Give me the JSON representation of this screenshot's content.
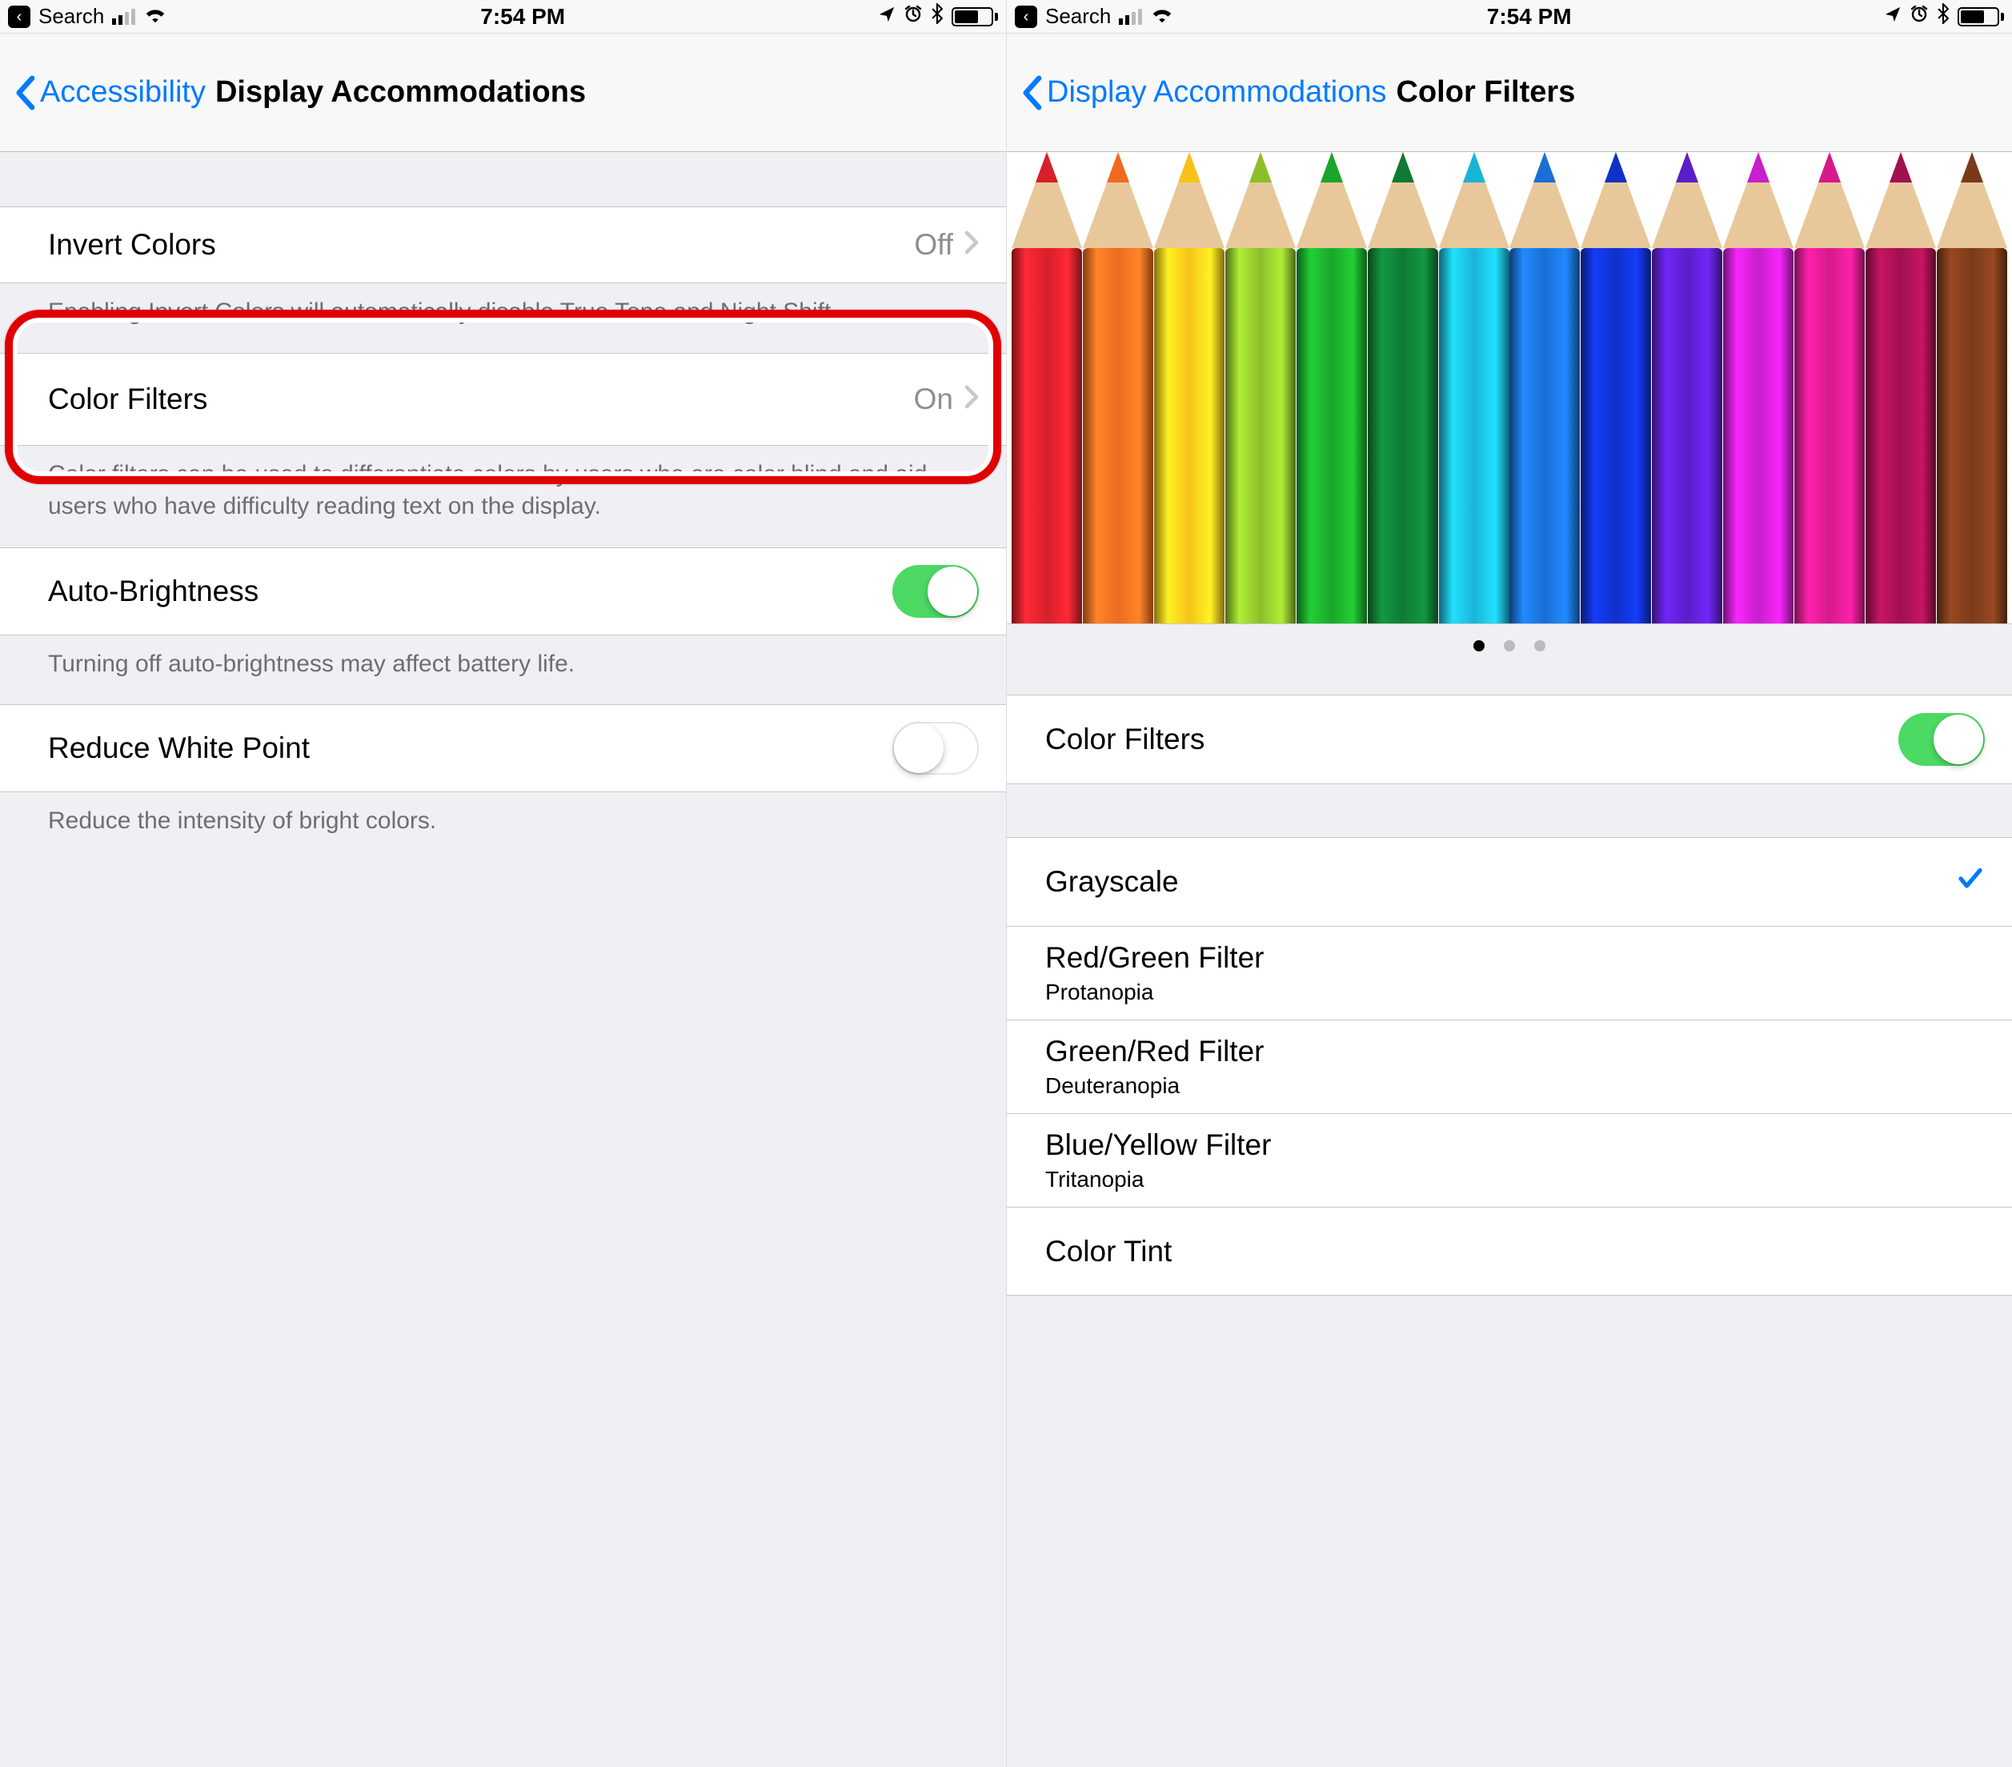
{
  "status": {
    "back_label": "Search",
    "time": "7:54 PM"
  },
  "left": {
    "nav_back": "Accessibility",
    "nav_title": "Display Accommodations",
    "invert": {
      "label": "Invert Colors",
      "value": "Off"
    },
    "invert_footer": "Enabling Invert Colors will automatically disable True Tone and Night Shift.",
    "color_filters": {
      "label": "Color Filters",
      "value": "On"
    },
    "color_filters_footer": "Color filters can be used to differentiate colors by users who are color blind and aid users who have difficulty reading text on the display.",
    "auto_brightness": {
      "label": "Auto-Brightness",
      "on": true
    },
    "auto_brightness_footer": "Turning off auto-brightness may affect battery life.",
    "reduce_white": {
      "label": "Reduce White Point",
      "on": false
    },
    "reduce_white_footer": "Reduce the intensity of bright colors."
  },
  "right": {
    "nav_back": "Display Accommodations",
    "nav_title": "Color Filters",
    "toggle": {
      "label": "Color Filters",
      "on": true
    },
    "options": [
      {
        "label": "Grayscale",
        "sub": "",
        "selected": true
      },
      {
        "label": "Red/Green Filter",
        "sub": "Protanopia",
        "selected": false
      },
      {
        "label": "Green/Red Filter",
        "sub": "Deuteranopia",
        "selected": false
      },
      {
        "label": "Blue/Yellow Filter",
        "sub": "Tritanopia",
        "selected": false
      },
      {
        "label": "Color Tint",
        "sub": "",
        "selected": false
      }
    ],
    "pencil_colors": [
      "#d6202a",
      "#ef6a1f",
      "#f6c21a",
      "#8dbe2a",
      "#1aa62a",
      "#0e7a34",
      "#1ab4d6",
      "#1a6ed6",
      "#1030c8",
      "#5a1ec8",
      "#c81ecb",
      "#d61a8a",
      "#a01050",
      "#7a3a1a"
    ],
    "page_dots": {
      "count": 3,
      "active": 0
    }
  }
}
